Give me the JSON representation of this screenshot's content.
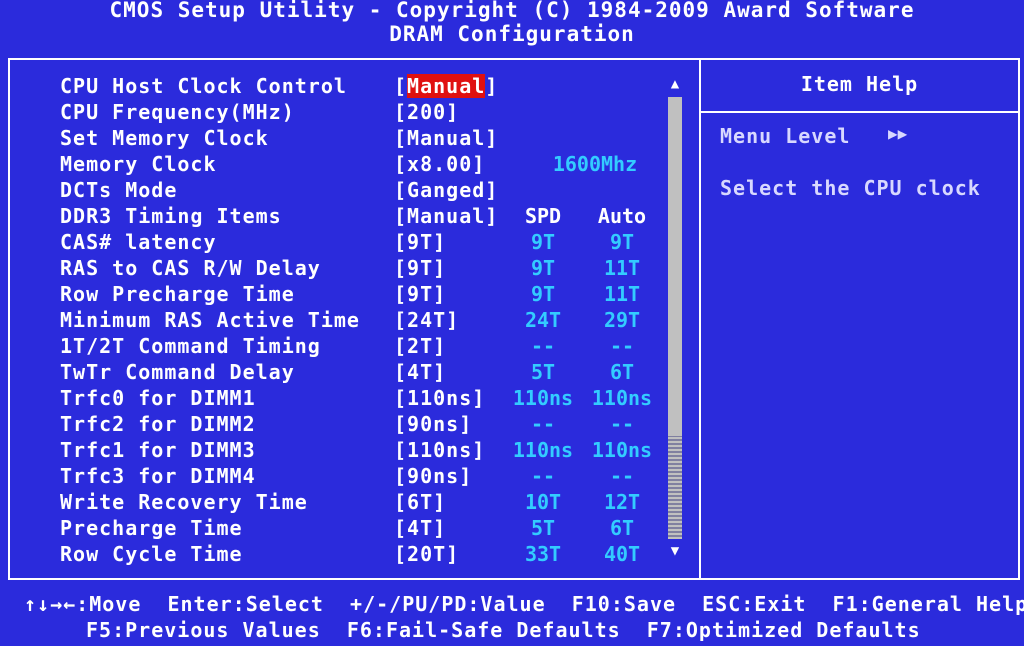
{
  "header": {
    "title": "CMOS Setup Utility - Copyright (C) 1984-2009 Award Software",
    "subtitle": "DRAM Configuration"
  },
  "items": [
    {
      "label": "CPU Host Clock Control",
      "value": "Manual",
      "spd": "",
      "auto": "",
      "selected": true
    },
    {
      "label": "CPU Frequency(MHz)",
      "value": "200",
      "spd": "",
      "auto": ""
    },
    {
      "label": "Set Memory Clock",
      "value": "Manual",
      "spd": "",
      "auto": ""
    },
    {
      "label": "Memory Clock",
      "value": "x8.00",
      "spd": "1600Mhz",
      "auto": ""
    },
    {
      "label": "DCTs Mode",
      "value": "Ganged",
      "spd": "",
      "auto": ""
    },
    {
      "label": "DDR3 Timing Items",
      "value": "Manual",
      "spd": "SPD",
      "auto": "Auto",
      "header": true
    },
    {
      "label": "CAS# latency",
      "value": "9T",
      "spd": "9T",
      "auto": "9T"
    },
    {
      "label": "RAS to CAS R/W Delay",
      "value": "9T",
      "spd": "9T",
      "auto": "11T"
    },
    {
      "label": "Row Precharge Time",
      "value": "9T",
      "spd": "9T",
      "auto": "11T"
    },
    {
      "label": "Minimum RAS Active Time",
      "value": "24T",
      "spd": "24T",
      "auto": "29T"
    },
    {
      "label": "1T/2T Command Timing",
      "value": "2T",
      "spd": "--",
      "auto": "--"
    },
    {
      "label": "TwTr Command Delay",
      "value": "4T",
      "spd": "5T",
      "auto": "6T"
    },
    {
      "label": "Trfc0 for DIMM1",
      "value": "110ns",
      "spd": "110ns",
      "auto": "110ns"
    },
    {
      "label": "Trfc2 for DIMM2",
      "value": "90ns",
      "spd": "--",
      "auto": "--"
    },
    {
      "label": "Trfc1 for DIMM3",
      "value": "110ns",
      "spd": "110ns",
      "auto": "110ns"
    },
    {
      "label": "Trfc3 for DIMM4",
      "value": "90ns",
      "spd": "--",
      "auto": "--"
    },
    {
      "label": "Write Recovery Time",
      "value": "6T",
      "spd": "10T",
      "auto": "12T"
    },
    {
      "label": "Precharge Time",
      "value": "4T",
      "spd": "5T",
      "auto": "6T"
    },
    {
      "label": "Row Cycle Time",
      "value": "20T",
      "spd": "33T",
      "auto": "40T"
    }
  ],
  "help": {
    "title": "Item Help",
    "menu_level": "Menu Level",
    "menu_level_arrows": "▶▶",
    "description": "Select the CPU clock"
  },
  "scroll": {
    "up": "▲",
    "down": "▼"
  },
  "footer": {
    "line1": "↑↓→←:Move  Enter:Select  +/-/PU/PD:Value  F10:Save  ESC:Exit  F1:General Help",
    "line2": "F5:Previous Values  F6:Fail-Safe Defaults  F7:Optimized Defaults"
  }
}
